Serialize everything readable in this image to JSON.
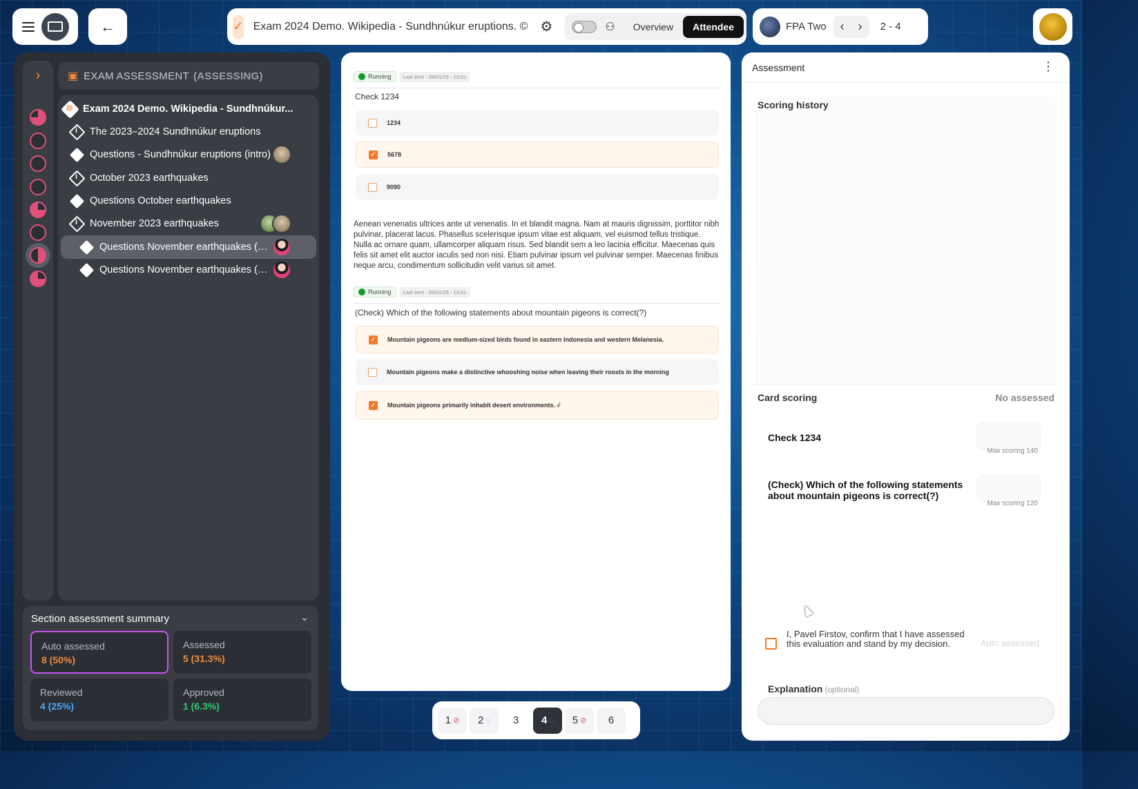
{
  "header": {
    "title": "Exam 2024 Demo. Wikipedia - Sundhnúkur eruptions. ©",
    "tabs": [
      {
        "label": "Overview",
        "active": false
      },
      {
        "label": "Attendee",
        "active": true
      }
    ],
    "user_name": "FPA Two",
    "range": "2 - 4"
  },
  "icons": {
    "menu": "hamburger-icon",
    "app": "monitor-icon",
    "back": "arrow-left-icon",
    "doc": "clipboard-check-icon",
    "settings": "gear-icon",
    "toggle": "toggle-icon",
    "mask": "incognito-icon",
    "prev": "chevron-left-icon",
    "next": "chevron-right-icon",
    "more": "vertical-dots-icon"
  },
  "sidebar": {
    "header_label": "EXAM ASSESSMENT",
    "header_status": "(ASSESSING)",
    "items": [
      {
        "label": "Exam 2024 Demo. Wikipedia - Sundhnúkur...",
        "kind": "exam"
      },
      {
        "label": "The 2023–2024 Sundhnúkur eruptions",
        "kind": "info"
      },
      {
        "label": "Questions - Sundhnúkur eruptions (intro)",
        "kind": "question"
      },
      {
        "label": "October 2023 earthquakes",
        "kind": "info"
      },
      {
        "label": "Questions October earthquakes",
        "kind": "question"
      },
      {
        "label": "November 2023 earthquakes",
        "kind": "info"
      },
      {
        "label": "Questions November earthquakes (part...",
        "kind": "question",
        "selected": true
      },
      {
        "label": "Questions November earthquakes (part...",
        "kind": "question"
      }
    ]
  },
  "summary": {
    "title": "Section assessment summary",
    "stats": [
      {
        "label": "Auto assessed",
        "value": "8 (50%)",
        "color": "#f08a3a"
      },
      {
        "label": "Assessed",
        "value": "5 (31.3%)",
        "color": "#f08a3a"
      },
      {
        "label": "Reviewed",
        "value": "4 (25%)",
        "color": "#4aa8ff"
      },
      {
        "label": "Approved",
        "value": "1 (6.3%)",
        "color": "#2ecc71"
      }
    ]
  },
  "questions": [
    {
      "status": "Running",
      "last_sent": "Last sent - 28/01/25 - 13:01",
      "title": "Check 1234",
      "options": [
        {
          "text": "1234",
          "checked": false
        },
        {
          "text": "5678",
          "checked": true
        },
        {
          "text": "9090",
          "checked": false
        }
      ]
    },
    {
      "status": "Running",
      "last_sent": "Last sent - 28/01/25 - 13:01",
      "title": "(Check) Which of the following statements about mountain pigeons is correct(?)",
      "options": [
        {
          "text": "Mountain pigeons are medium-sized birds found in eastern Indonesia and western Melanesia.",
          "checked": true
        },
        {
          "text": "Mountain pigeons make a distinctive whooshing noise when leaving their roosts in the morning",
          "checked": false
        },
        {
          "text": "Mountain pigeons primarily inhabit desert environments. √",
          "checked": true
        }
      ]
    }
  ],
  "paragraph": "Aenean venenatis ultrices ante ut venenatis. In et blandit magna. Nam at mauris dignissim, porttitor nibh pulvinar, placerat lacus. Phasellus scelerisque ipsum vitae est aliquam, vel euismod tellus tristique. Nulla ac ornare quam, ullamcorper aliquam risus. Sed blandit sem a leo lacinia efficitur. Maecenas quis felis sit amet elit auctor iaculis sed non nisi. Etiam pulvinar ipsum vel pulvinar semper. Maecenas finibus neque arcu, condimentum sollicitudin velit varius sit amet.",
  "pager": {
    "pages": [
      {
        "label": "1",
        "mark": "done"
      },
      {
        "label": "2",
        "mark": "partial"
      },
      {
        "label": "3",
        "mark": "none"
      },
      {
        "label": "4",
        "mark": "partial",
        "active": true
      },
      {
        "label": "5",
        "mark": "done"
      },
      {
        "label": "6",
        "mark": "none"
      }
    ]
  },
  "assessment": {
    "title": "Assessment",
    "scoring_history": "Scoring history",
    "card_scoring": "Card scoring",
    "card_status": "No assessed",
    "cards": [
      {
        "name": "Check 1234",
        "max": "Max scoring 140"
      },
      {
        "name": "(Check) Which of the following statements about mountain pigeons is correct(?)",
        "max": "Max scoring 120"
      }
    ],
    "confirm_text": "I, Pavel Firstov, confirm that I have assessed this evaluation and stand by my decision.",
    "auto_assessed": "Auto assessed",
    "explanation_label": "Explanation",
    "explanation_optional": "(optional)"
  }
}
